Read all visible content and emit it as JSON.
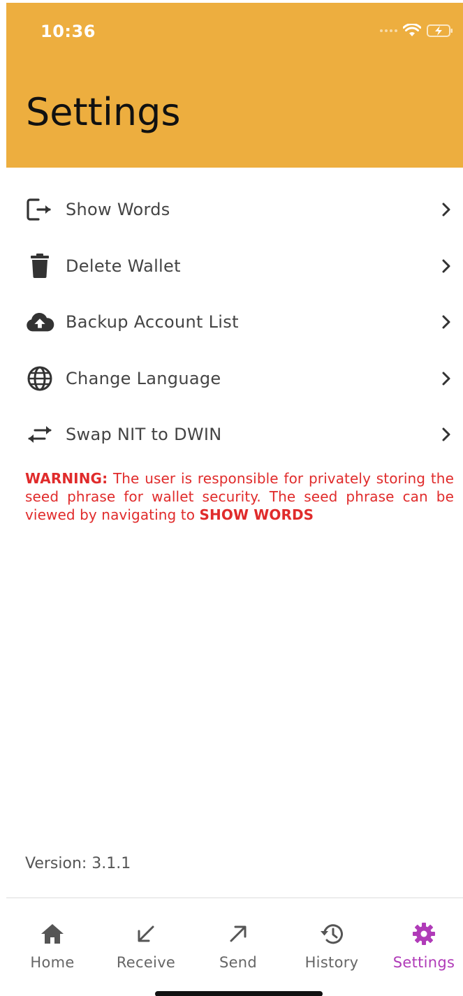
{
  "status_bar": {
    "time": "10:36",
    "icons": [
      "signal-dots",
      "wifi-icon",
      "battery-charging-icon"
    ]
  },
  "header": {
    "title": "Settings",
    "background_color": "#EDAE3F"
  },
  "menu": [
    {
      "label": "Show Words",
      "icon": "logout-icon"
    },
    {
      "label": "Delete Wallet",
      "icon": "trash-icon"
    },
    {
      "label": "Backup Account List",
      "icon": "cloud-upload-icon"
    },
    {
      "label": "Change Language",
      "icon": "globe-icon"
    },
    {
      "label": "Swap NIT to DWIN",
      "icon": "swap-arrows-icon"
    }
  ],
  "warning": {
    "prefix": "WARNING:",
    "text": " The user is responsible for privately storing the seed phrase for wallet security.  The seed phrase can be viewed by navigating to ",
    "link": "SHOW WORDS",
    "color": "#E02B2B"
  },
  "version": "Version: 3.1.1",
  "tabs": [
    {
      "label": "Home",
      "icon": "home-icon",
      "active": false
    },
    {
      "label": "Receive",
      "icon": "arrow-down-left-icon",
      "active": false
    },
    {
      "label": "Send",
      "icon": "arrow-up-right-icon",
      "active": false
    },
    {
      "label": "History",
      "icon": "history-icon",
      "active": false
    },
    {
      "label": "Settings",
      "icon": "gear-icon",
      "active": true
    }
  ],
  "active_tab_color": "#B03BB8"
}
